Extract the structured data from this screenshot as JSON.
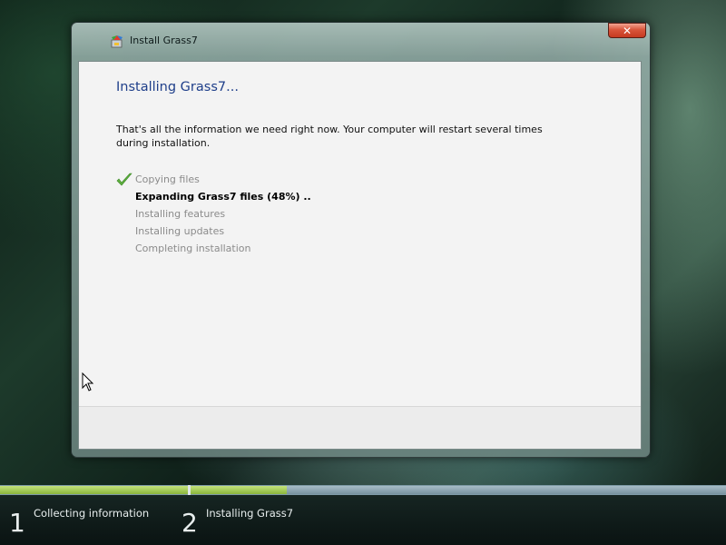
{
  "window": {
    "title": "Install Grass7",
    "close_label": "✕"
  },
  "content": {
    "heading": "Installing Grass7...",
    "info": "That's all the information we need right now. Your computer will restart several times during installation.",
    "steps": [
      {
        "label": "Copying files",
        "status": "done"
      },
      {
        "label": "Expanding Grass7 files (48%) ..",
        "status": "current"
      },
      {
        "label": "Installing features",
        "status": "pending"
      },
      {
        "label": "Installing updates",
        "status": "pending"
      },
      {
        "label": "Completing installation",
        "status": "pending"
      }
    ]
  },
  "taskbar": {
    "stage1_progress": 1.0,
    "stage2_progress": 0.18,
    "stages": [
      {
        "number": "1",
        "label": "Collecting information"
      },
      {
        "number": "2",
        "label": "Installing Grass7"
      }
    ]
  },
  "colors": {
    "heading": "#1f3f8a",
    "progress_fill": "#8ab63b",
    "progress_track": "#7f9ba7"
  }
}
